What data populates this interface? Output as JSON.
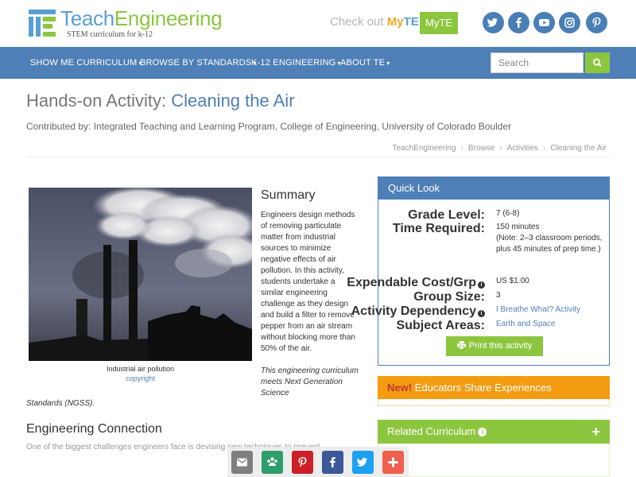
{
  "header": {
    "logo_teach": "Teach",
    "logo_engineering": "Engineering",
    "tagline": "STEM curriculum for k-12",
    "checkout_text": "Check out",
    "checkout_my": "My",
    "checkout_te": "TE",
    "myte_button": "MyTE",
    "social": [
      "twitter-icon",
      "facebook-icon",
      "youtube-icon",
      "instagram-icon",
      "pinterest-icon"
    ],
    "brand_blue": "#4f7fb7",
    "brand_green": "#8cc63f"
  },
  "nav": {
    "items": [
      {
        "label": "SHOW ME CURRICULUM"
      },
      {
        "label": "BROWSE BY STANDARDS"
      },
      {
        "label": "K-12 ENGINEERING"
      },
      {
        "label": "ABOUT TE"
      }
    ],
    "caret": "▾",
    "search_placeholder": "Search"
  },
  "page": {
    "title_prefix": "Hands-on Activity:",
    "title_name": "Cleaning the Air",
    "contributed": "Contributed by: Integrated Teaching and Learning Program, College of Engineering, University of Colorado Boulder",
    "breadcrumb": [
      "TeachEngineering",
      "Browse",
      "Activities",
      "Cleaning the Air"
    ],
    "breadcrumb_sep": "›"
  },
  "media": {
    "caption": "Industrial air pollution",
    "copyright": "copyright"
  },
  "summary": {
    "heading": "Summary",
    "text": "Engineers design methods of removing particulate matter from industrial sources to minimize negative effects of air pollution. In this activity, students undertake a similar engineering challenge as they design and build a filter to remove pepper from an air stream without blocking more than 50% of the air.",
    "ngss_a": "This engineering curriculum meets Next Generation Science",
    "ngss_b": "Standards (NGSS)."
  },
  "engineering": {
    "heading": "Engineering Connection",
    "text": "One of the biggest challenges engineers face is devising new techniques to prevent"
  },
  "quick_look": {
    "heading": "Quick Look",
    "rows": [
      {
        "label": "Grade Level:",
        "value": "7 (6-8)"
      },
      {
        "label": "Time Required:",
        "value": "150 minutes",
        "note": "(Note: 2–3 classroom periods, plus 45 minutes of prep time.)"
      },
      {
        "label": "Expendable Cost/Grp",
        "value": "US $1.00"
      },
      {
        "label": "Group Size:",
        "value": "3"
      },
      {
        "label": "Activity Dependency",
        "value": "I Breathe What? Activity"
      },
      {
        "label": "Subject Areas:",
        "value": "Earth and Space"
      }
    ],
    "print_button": "Print this activity"
  },
  "new_bar": {
    "new": "New!",
    "text": " Educators Share Experiences"
  },
  "related": {
    "label": "Related Curriculum",
    "plus": "+"
  },
  "share_bar": [
    "email-icon",
    "share-icon",
    "pinterest-icon",
    "facebook-icon",
    "twitter-icon",
    "plus-icon"
  ]
}
